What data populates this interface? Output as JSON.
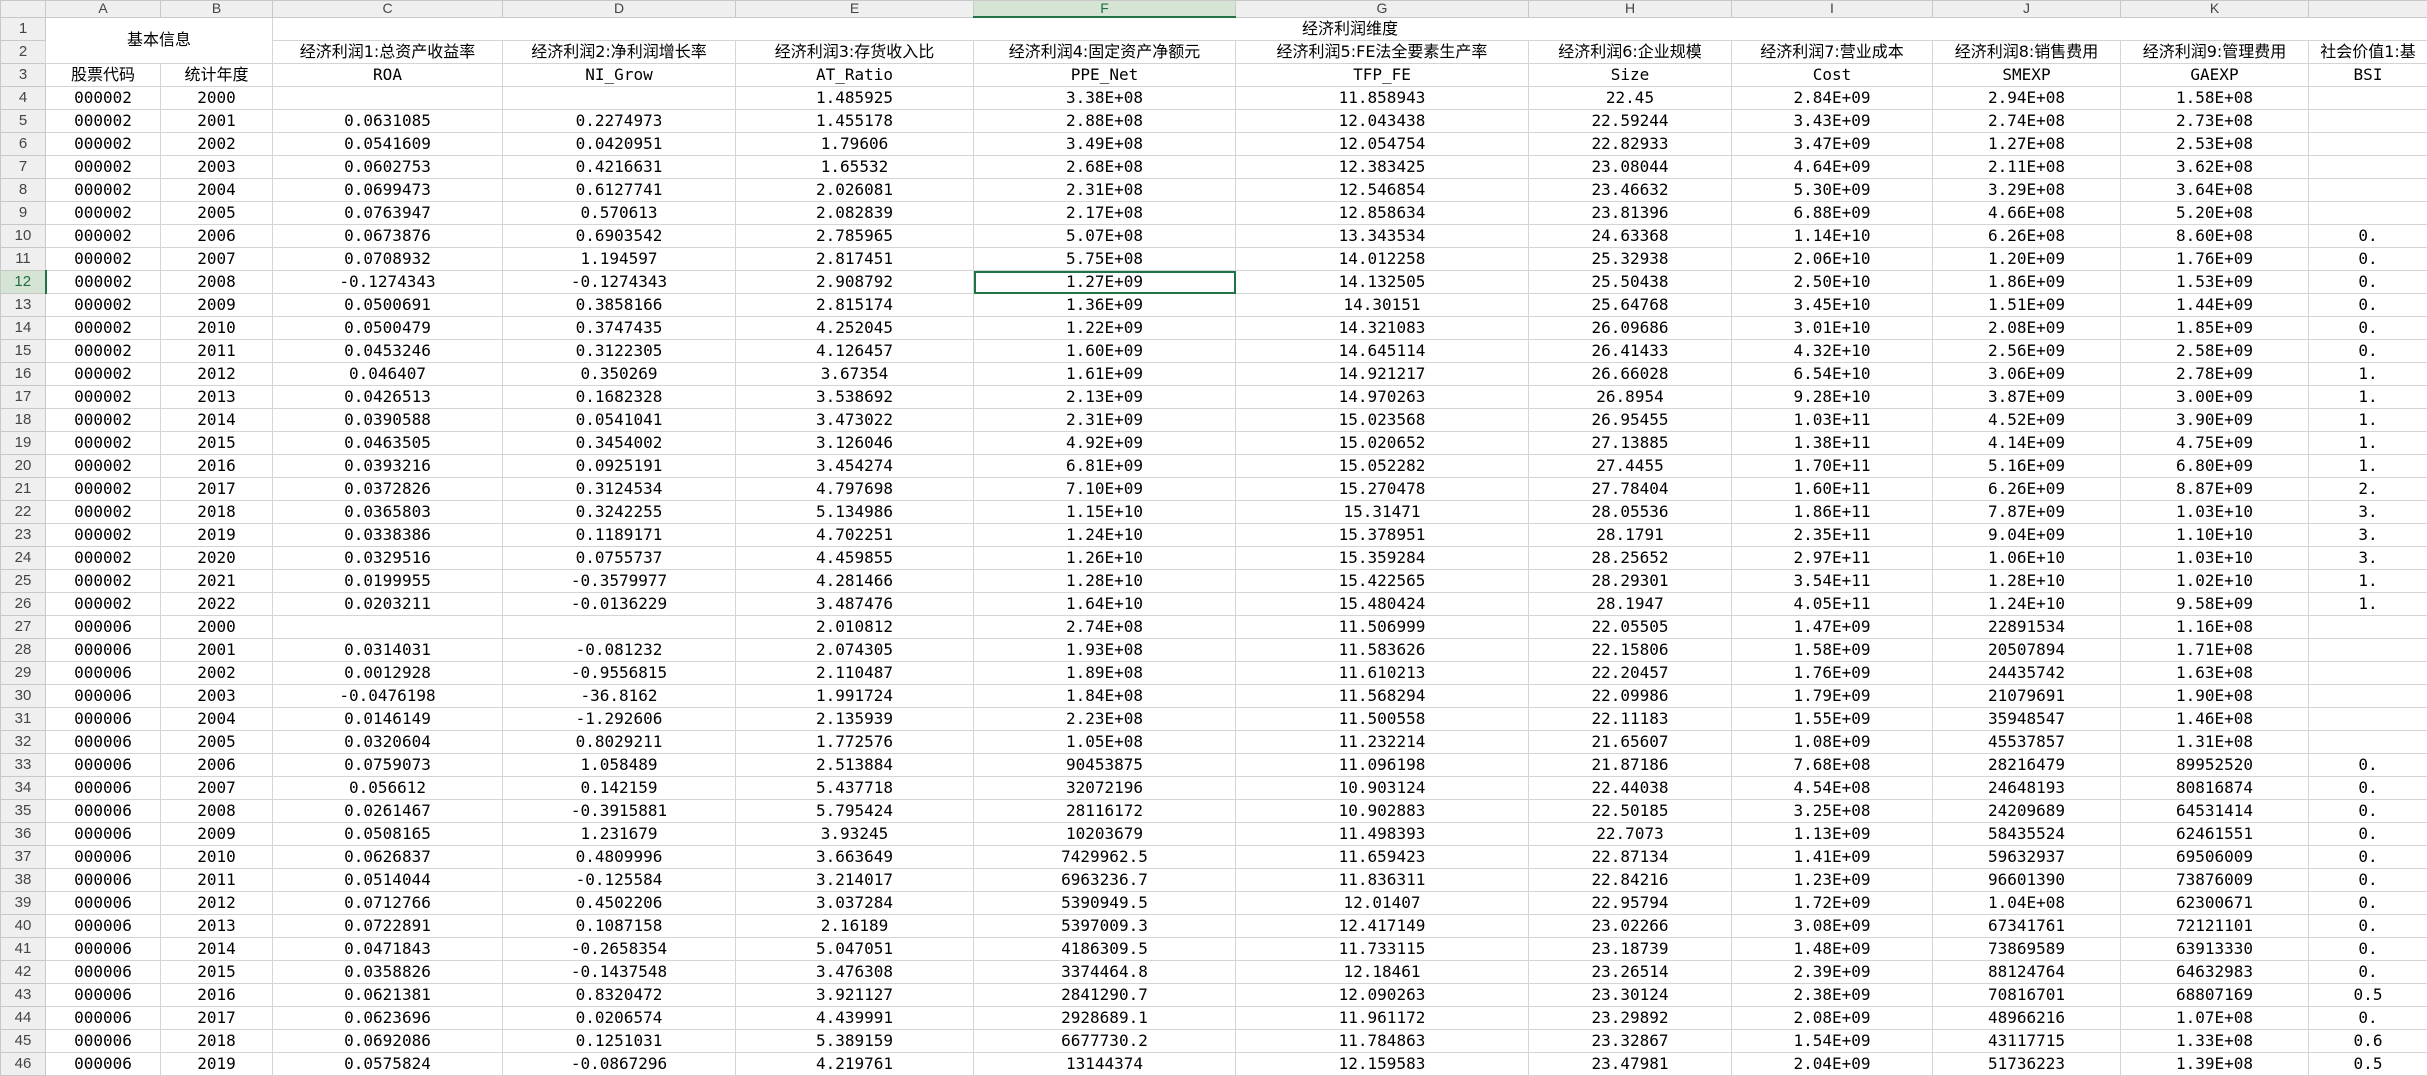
{
  "sheet": {
    "column_letters": [
      "A",
      "B",
      "C",
      "D",
      "E",
      "F",
      "G",
      "H",
      "I",
      "J",
      "K"
    ],
    "selected_cell": "F12",
    "row1": {
      "group_basic": "基本信息",
      "group_econ": "经济利润维度"
    },
    "row2": [
      "经济利润1:总资产收益率",
      "经济利润2:净利润增长率",
      "经济利润3:存货收入比",
      "经济利润4:固定资产净额元",
      "经济利润5:FE法全要素生产率",
      "经济利润6:企业规模",
      "经济利润7:营业成本",
      "经济利润8:销售费用",
      "经济利润9:管理费用",
      "社会价值1:基"
    ],
    "row3": [
      "股票代码",
      "统计年度",
      "ROA",
      "NI_Grow",
      "AT_Ratio",
      "PPE_Net",
      "TFP_FE",
      "Size",
      "Cost",
      "SMEXP",
      "GAEXP",
      "BSI"
    ],
    "rows": [
      {
        "n": "4",
        "c": [
          "000002",
          "2000",
          "",
          "",
          "1.485925",
          "3.38E+08",
          "11.858943",
          "22.45",
          "2.84E+09",
          "2.94E+08",
          "1.58E+08",
          ""
        ]
      },
      {
        "n": "5",
        "c": [
          "000002",
          "2001",
          "0.0631085",
          "0.2274973",
          "1.455178",
          "2.88E+08",
          "12.043438",
          "22.59244",
          "3.43E+09",
          "2.74E+08",
          "2.73E+08",
          ""
        ]
      },
      {
        "n": "6",
        "c": [
          "000002",
          "2002",
          "0.0541609",
          "0.0420951",
          "1.79606",
          "3.49E+08",
          "12.054754",
          "22.82933",
          "3.47E+09",
          "1.27E+08",
          "2.53E+08",
          ""
        ]
      },
      {
        "n": "7",
        "c": [
          "000002",
          "2003",
          "0.0602753",
          "0.4216631",
          "1.65532",
          "2.68E+08",
          "12.383425",
          "23.08044",
          "4.64E+09",
          "2.11E+08",
          "3.62E+08",
          ""
        ]
      },
      {
        "n": "8",
        "c": [
          "000002",
          "2004",
          "0.0699473",
          "0.6127741",
          "2.026081",
          "2.31E+08",
          "12.546854",
          "23.46632",
          "5.30E+09",
          "3.29E+08",
          "3.64E+08",
          ""
        ]
      },
      {
        "n": "9",
        "c": [
          "000002",
          "2005",
          "0.0763947",
          "0.570613",
          "2.082839",
          "2.17E+08",
          "12.858634",
          "23.81396",
          "6.88E+09",
          "4.66E+08",
          "5.20E+08",
          ""
        ]
      },
      {
        "n": "10",
        "c": [
          "000002",
          "2006",
          "0.0673876",
          "0.6903542",
          "2.785965",
          "5.07E+08",
          "13.343534",
          "24.63368",
          "1.14E+10",
          "6.26E+08",
          "8.60E+08",
          "0."
        ]
      },
      {
        "n": "11",
        "c": [
          "000002",
          "2007",
          "0.0708932",
          "1.194597",
          "2.817451",
          "5.75E+08",
          "14.012258",
          "25.32938",
          "2.06E+10",
          "1.20E+09",
          "1.76E+09",
          "0."
        ]
      },
      {
        "n": "12",
        "c": [
          "000002",
          "2008",
          "-0.1274343",
          "-0.1274343",
          "2.908792",
          "1.27E+09",
          "14.132505",
          "25.50438",
          "2.50E+10",
          "1.86E+09",
          "1.53E+09",
          "0."
        ]
      },
      {
        "n": "13",
        "c": [
          "000002",
          "2009",
          "0.0500691",
          "0.3858166",
          "2.815174",
          "1.36E+09",
          "14.30151",
          "25.64768",
          "3.45E+10",
          "1.51E+09",
          "1.44E+09",
          "0."
        ]
      },
      {
        "n": "14",
        "c": [
          "000002",
          "2010",
          "0.0500479",
          "0.3747435",
          "4.252045",
          "1.22E+09",
          "14.321083",
          "26.09686",
          "3.01E+10",
          "2.08E+09",
          "1.85E+09",
          "0."
        ]
      },
      {
        "n": "15",
        "c": [
          "000002",
          "2011",
          "0.0453246",
          "0.3122305",
          "4.126457",
          "1.60E+09",
          "14.645114",
          "26.41433",
          "4.32E+10",
          "2.56E+09",
          "2.58E+09",
          "0."
        ]
      },
      {
        "n": "16",
        "c": [
          "000002",
          "2012",
          "0.046407",
          "0.350269",
          "3.67354",
          "1.61E+09",
          "14.921217",
          "26.66028",
          "6.54E+10",
          "3.06E+09",
          "2.78E+09",
          "1."
        ]
      },
      {
        "n": "17",
        "c": [
          "000002",
          "2013",
          "0.0426513",
          "0.1682328",
          "3.538692",
          "2.13E+09",
          "14.970263",
          "26.8954",
          "9.28E+10",
          "3.87E+09",
          "3.00E+09",
          "1."
        ]
      },
      {
        "n": "18",
        "c": [
          "000002",
          "2014",
          "0.0390588",
          "0.0541041",
          "3.473022",
          "2.31E+09",
          "15.023568",
          "26.95455",
          "1.03E+11",
          "4.52E+09",
          "3.90E+09",
          "1."
        ]
      },
      {
        "n": "19",
        "c": [
          "000002",
          "2015",
          "0.0463505",
          "0.3454002",
          "3.126046",
          "4.92E+09",
          "15.020652",
          "27.13885",
          "1.38E+11",
          "4.14E+09",
          "4.75E+09",
          "1."
        ]
      },
      {
        "n": "20",
        "c": [
          "000002",
          "2016",
          "0.0393216",
          "0.0925191",
          "3.454274",
          "6.81E+09",
          "15.052282",
          "27.4455",
          "1.70E+11",
          "5.16E+09",
          "6.80E+09",
          "1."
        ]
      },
      {
        "n": "21",
        "c": [
          "000002",
          "2017",
          "0.0372826",
          "0.3124534",
          "4.797698",
          "7.10E+09",
          "15.270478",
          "27.78404",
          "1.60E+11",
          "6.26E+09",
          "8.87E+09",
          "2."
        ]
      },
      {
        "n": "22",
        "c": [
          "000002",
          "2018",
          "0.0365803",
          "0.3242255",
          "5.134986",
          "1.15E+10",
          "15.31471",
          "28.05536",
          "1.86E+11",
          "7.87E+09",
          "1.03E+10",
          "3."
        ]
      },
      {
        "n": "23",
        "c": [
          "000002",
          "2019",
          "0.0338386",
          "0.1189171",
          "4.702251",
          "1.24E+10",
          "15.378951",
          "28.1791",
          "2.35E+11",
          "9.04E+09",
          "1.10E+10",
          "3."
        ]
      },
      {
        "n": "24",
        "c": [
          "000002",
          "2020",
          "0.0329516",
          "0.0755737",
          "4.459855",
          "1.26E+10",
          "15.359284",
          "28.25652",
          "2.97E+11",
          "1.06E+10",
          "1.03E+10",
          "3."
        ]
      },
      {
        "n": "25",
        "c": [
          "000002",
          "2021",
          "0.0199955",
          "-0.3579977",
          "4.281466",
          "1.28E+10",
          "15.422565",
          "28.29301",
          "3.54E+11",
          "1.28E+10",
          "1.02E+10",
          "1."
        ]
      },
      {
        "n": "26",
        "c": [
          "000002",
          "2022",
          "0.0203211",
          "-0.0136229",
          "3.487476",
          "1.64E+10",
          "15.480424",
          "28.1947",
          "4.05E+11",
          "1.24E+10",
          "9.58E+09",
          "1."
        ]
      },
      {
        "n": "27",
        "c": [
          "000006",
          "2000",
          "",
          "",
          "2.010812",
          "2.74E+08",
          "11.506999",
          "22.05505",
          "1.47E+09",
          "22891534",
          "1.16E+08",
          ""
        ]
      },
      {
        "n": "28",
        "c": [
          "000006",
          "2001",
          "0.0314031",
          "-0.081232",
          "2.074305",
          "1.93E+08",
          "11.583626",
          "22.15806",
          "1.58E+09",
          "20507894",
          "1.71E+08",
          ""
        ]
      },
      {
        "n": "29",
        "c": [
          "000006",
          "2002",
          "0.0012928",
          "-0.9556815",
          "2.110487",
          "1.89E+08",
          "11.610213",
          "22.20457",
          "1.76E+09",
          "24435742",
          "1.63E+08",
          ""
        ]
      },
      {
        "n": "30",
        "c": [
          "000006",
          "2003",
          "-0.0476198",
          "-36.8162",
          "1.991724",
          "1.84E+08",
          "11.568294",
          "22.09986",
          "1.79E+09",
          "21079691",
          "1.90E+08",
          ""
        ]
      },
      {
        "n": "31",
        "c": [
          "000006",
          "2004",
          "0.0146149",
          "-1.292606",
          "2.135939",
          "2.23E+08",
          "11.500558",
          "22.11183",
          "1.55E+09",
          "35948547",
          "1.46E+08",
          ""
        ]
      },
      {
        "n": "32",
        "c": [
          "000006",
          "2005",
          "0.0320604",
          "0.8029211",
          "1.772576",
          "1.05E+08",
          "11.232214",
          "21.65607",
          "1.08E+09",
          "45537857",
          "1.31E+08",
          ""
        ]
      },
      {
        "n": "33",
        "c": [
          "000006",
          "2006",
          "0.0759073",
          "1.058489",
          "2.513884",
          "90453875",
          "11.096198",
          "21.87186",
          "7.68E+08",
          "28216479",
          "89952520",
          "0."
        ]
      },
      {
        "n": "34",
        "c": [
          "000006",
          "2007",
          "0.056612",
          "0.142159",
          "5.437718",
          "32072196",
          "10.903124",
          "22.44038",
          "4.54E+08",
          "24648193",
          "80816874",
          "0."
        ]
      },
      {
        "n": "35",
        "c": [
          "000006",
          "2008",
          "0.0261467",
          "-0.3915881",
          "5.795424",
          "28116172",
          "10.902883",
          "22.50185",
          "3.25E+08",
          "24209689",
          "64531414",
          "0."
        ]
      },
      {
        "n": "36",
        "c": [
          "000006",
          "2009",
          "0.0508165",
          "1.231679",
          "3.93245",
          "10203679",
          "11.498393",
          "22.7073",
          "1.13E+09",
          "58435524",
          "62461551",
          "0."
        ]
      },
      {
        "n": "37",
        "c": [
          "000006",
          "2010",
          "0.0626837",
          "0.4809996",
          "3.663649",
          "7429962.5",
          "11.659423",
          "22.87134",
          "1.41E+09",
          "59632937",
          "69506009",
          "0."
        ]
      },
      {
        "n": "38",
        "c": [
          "000006",
          "2011",
          "0.0514044",
          "-0.125584",
          "3.214017",
          "6963236.7",
          "11.836311",
          "22.84216",
          "1.23E+09",
          "96601390",
          "73876009",
          "0."
        ]
      },
      {
        "n": "39",
        "c": [
          "000006",
          "2012",
          "0.0712766",
          "0.4502206",
          "3.037284",
          "5390949.5",
          "12.01407",
          "22.95794",
          "1.72E+09",
          "1.04E+08",
          "62300671",
          "0."
        ]
      },
      {
        "n": "40",
        "c": [
          "000006",
          "2013",
          "0.0722891",
          "0.1087158",
          "2.16189",
          "5397009.3",
          "12.417149",
          "23.02266",
          "3.08E+09",
          "67341761",
          "72121101",
          "0."
        ]
      },
      {
        "n": "41",
        "c": [
          "000006",
          "2014",
          "0.0471843",
          "-0.2658354",
          "5.047051",
          "4186309.5",
          "11.733115",
          "23.18739",
          "1.48E+09",
          "73869589",
          "63913330",
          "0."
        ]
      },
      {
        "n": "42",
        "c": [
          "000006",
          "2015",
          "0.0358826",
          "-0.1437548",
          "3.476308",
          "3374464.8",
          "12.18461",
          "23.26514",
          "2.39E+09",
          "88124764",
          "64632983",
          "0."
        ]
      },
      {
        "n": "43",
        "c": [
          "000006",
          "2016",
          "0.0621381",
          "0.8320472",
          "3.921127",
          "2841290.7",
          "12.090263",
          "23.30124",
          "2.38E+09",
          "70816701",
          "68807169",
          "0.5"
        ]
      },
      {
        "n": "44",
        "c": [
          "000006",
          "2017",
          "0.0623696",
          "0.0206574",
          "4.439991",
          "2928689.1",
          "11.961172",
          "23.29892",
          "2.08E+09",
          "48966216",
          "1.07E+08",
          "0."
        ]
      },
      {
        "n": "45",
        "c": [
          "000006",
          "2018",
          "0.0692086",
          "0.1251031",
          "5.389159",
          "6677730.2",
          "11.784863",
          "23.32867",
          "1.54E+09",
          "43117715",
          "1.33E+08",
          "0.6"
        ]
      },
      {
        "n": "46",
        "c": [
          "000006",
          "2019",
          "0.0575824",
          "-0.0867296",
          "4.219761",
          "13144374",
          "12.159583",
          "23.47981",
          "2.04E+09",
          "51736223",
          "1.39E+08",
          "0.5"
        ]
      }
    ]
  }
}
